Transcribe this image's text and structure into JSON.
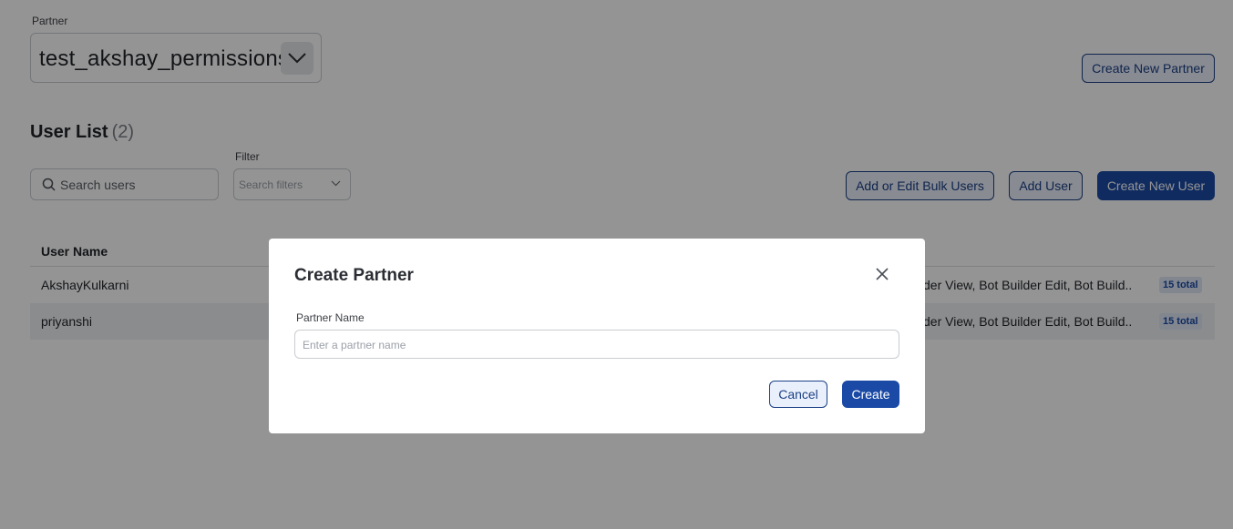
{
  "partner": {
    "label": "Partner",
    "selected_value": "test_akshay_permissions",
    "create_button": "Create New Partner"
  },
  "user_list": {
    "title": "User List",
    "count": "(2)",
    "search_placeholder": "Search users",
    "filter_label": "Filter",
    "filter_placeholder": "Search filters",
    "buttons": {
      "bulk": "Add or Edit Bulk Users",
      "add": "Add User",
      "create": "Create New User"
    },
    "column_username": "User Name",
    "rows": [
      {
        "name": "AkshayKulkarni",
        "permissions": "der View, Bot Builder Edit, Bot Build...",
        "badge": "15 total"
      },
      {
        "name": "priyanshi",
        "permissions": "der View, Bot Builder Edit, Bot Build...",
        "badge": "15 total"
      }
    ]
  },
  "modal": {
    "title": "Create Partner",
    "field_label": "Partner Name",
    "field_placeholder": "Enter a partner name",
    "field_value": "",
    "cancel": "Cancel",
    "create": "Create"
  },
  "colors": {
    "primary": "#1a4aa6",
    "outline_border": "#1b3f85",
    "outline_bg": "#eaf0fb",
    "badge_bg": "#dfe7f7",
    "overlay": "rgba(0,0,0,0.42)"
  },
  "icons": [
    "chevron-down-icon",
    "search-icon",
    "close-icon"
  ]
}
